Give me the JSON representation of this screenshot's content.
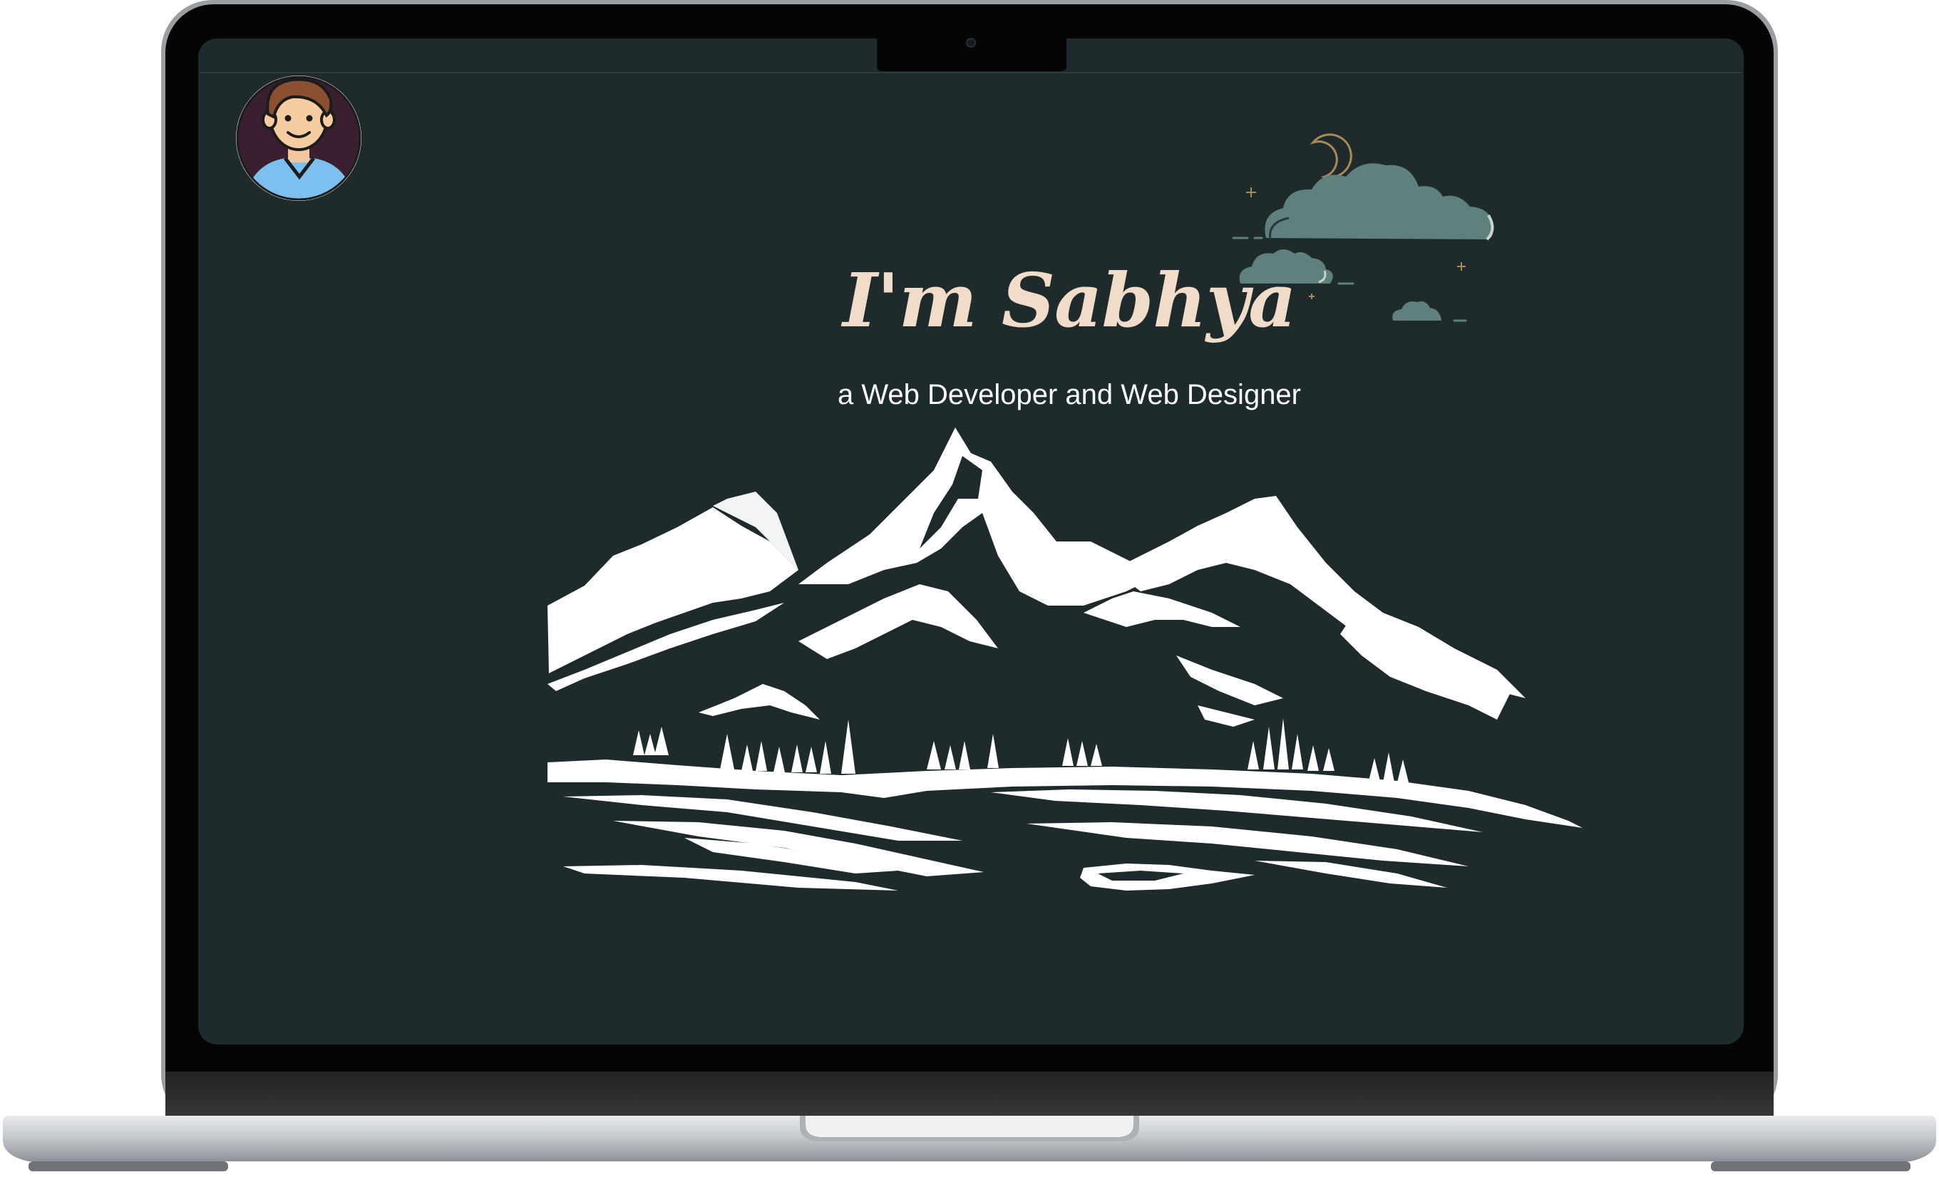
{
  "hero": {
    "title": "I'm Sabhya",
    "subtitle": "a Web Developer and Web Designer"
  },
  "icons": {
    "avatar": "user-avatar",
    "moon": "crescent-moon-icon",
    "clouds": "cloud-icon",
    "mountains": "mountain-illustration",
    "camera": "webcam-icon"
  },
  "colors": {
    "screen_background": "#1e2a2b",
    "title_color": "#f0dcc8",
    "subtitle_color": "#ffffff",
    "cloud_fill": "#5f807d",
    "moon_stroke": "#a88a55",
    "mountain_fill": "#ffffff",
    "laptop_frame": "#0b0b0b",
    "laptop_base": "#c9ccd0"
  }
}
